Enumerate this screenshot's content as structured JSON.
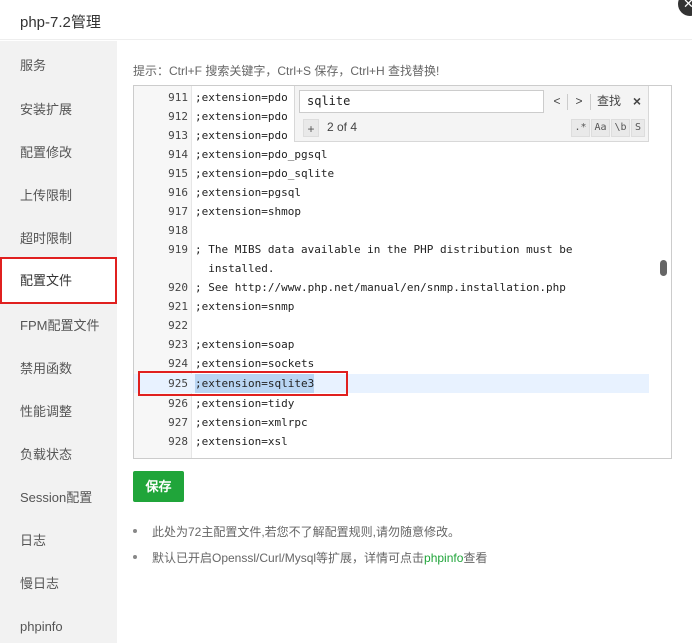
{
  "window": {
    "title": "php-7.2管理",
    "close_icon": "close-icon"
  },
  "sidebar": {
    "items": [
      {
        "label": "服务"
      },
      {
        "label": "安装扩展"
      },
      {
        "label": "配置修改"
      },
      {
        "label": "上传限制"
      },
      {
        "label": "超时限制"
      },
      {
        "label": "配置文件",
        "active": true
      },
      {
        "label": "FPM配置文件"
      },
      {
        "label": "禁用函数"
      },
      {
        "label": "性能调整"
      },
      {
        "label": "负载状态"
      },
      {
        "label": "Session配置"
      },
      {
        "label": "日志"
      },
      {
        "label": "慢日志"
      },
      {
        "label": "phpinfo"
      }
    ]
  },
  "hint": "提示：Ctrl+F 搜索关键字，Ctrl+S 保存，Ctrl+H 查找替换!",
  "editor": {
    "lines": [
      {
        "n": "911",
        "t": ";extension=pdo"
      },
      {
        "n": "912",
        "t": ";extension=pdo"
      },
      {
        "n": "913",
        "t": ";extension=pdo"
      },
      {
        "n": "914",
        "t": ";extension=pdo_pgsql"
      },
      {
        "n": "915",
        "t": ";extension=pdo_sqlite"
      },
      {
        "n": "916",
        "t": ";extension=pgsql"
      },
      {
        "n": "917",
        "t": ";extension=shmop"
      },
      {
        "n": "918",
        "t": ""
      },
      {
        "n": "919",
        "t": "; The MIBS data available in the PHP distribution must be"
      },
      {
        "n": "",
        "t": "  installed."
      },
      {
        "n": "920",
        "t": "; See http://www.php.net/manual/en/snmp.installation.php"
      },
      {
        "n": "921",
        "t": ";extension=snmp"
      },
      {
        "n": "922",
        "t": ""
      },
      {
        "n": "923",
        "t": ";extension=soap"
      },
      {
        "n": "924",
        "t": ";extension=sockets"
      },
      {
        "n": "925",
        "t": ";extension=sqlite3",
        "highlight": true
      },
      {
        "n": "926",
        "t": ";extension=tidy"
      },
      {
        "n": "927",
        "t": ";extension=xmlrpc"
      },
      {
        "n": "928",
        "t": ";extension=xsl"
      }
    ]
  },
  "find": {
    "query": "sqlite",
    "prev": "<",
    "next": ">",
    "search_label": "查找",
    "close": "×",
    "plus": "+",
    "match_count": "2 of 4",
    "regex_opt": ".*",
    "case_opt": "Aa",
    "word_opt": "\\b",
    "selection_opt": "S"
  },
  "save_label": "保存",
  "notes": {
    "note1": "此处为72主配置文件,若您不了解配置规则,请勿随意修改。",
    "note2_prefix": "默认已开启Openssl/Curl/Mysql等扩展，详情可点击",
    "note2_link": "phpinfo",
    "note2_suffix": "查看"
  },
  "colors": {
    "accent": "#20a53a",
    "highlight_border": "#e0201f"
  }
}
